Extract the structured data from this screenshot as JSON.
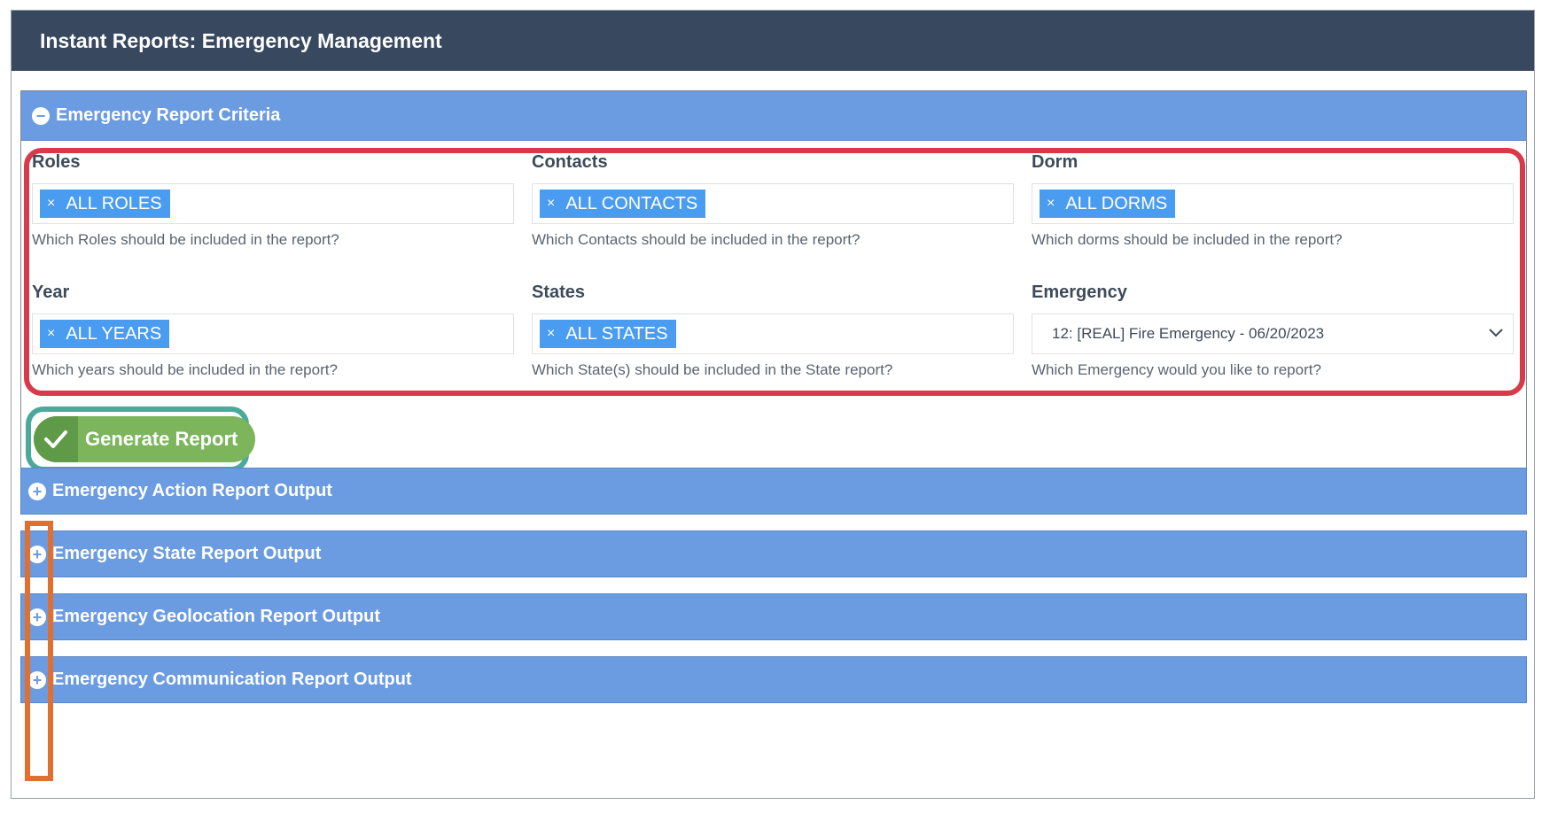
{
  "header": {
    "title": "Instant Reports: Emergency Management"
  },
  "criteria": {
    "title": "Emergency Report Criteria",
    "fields": {
      "roles": {
        "label": "Roles",
        "tag": "ALL ROLES",
        "help": "Which Roles should be included in the report?"
      },
      "contacts": {
        "label": "Contacts",
        "tag": "ALL CONTACTS",
        "help": "Which Contacts should be included in the report?"
      },
      "dorm": {
        "label": "Dorm",
        "tag": "ALL DORMS",
        "help": "Which dorms should be included in the report?"
      },
      "year": {
        "label": "Year",
        "tag": "ALL YEARS",
        "help": "Which years should be included in the report?"
      },
      "states": {
        "label": "States",
        "tag": "ALL STATES",
        "help": "Which State(s) should be included in the State report?"
      },
      "emergency": {
        "label": "Emergency",
        "value": "12: [REAL] Fire Emergency - 06/20/2023",
        "help": "Which Emergency would you like to report?"
      }
    },
    "tag_remove": "×",
    "generate_label": "Generate Report"
  },
  "outputs": [
    {
      "title": "Emergency Action Report Output"
    },
    {
      "title": "Emergency State Report Output"
    },
    {
      "title": "Emergency Geolocation Report Output"
    },
    {
      "title": "Emergency Communication Report Output"
    }
  ],
  "colors": {
    "header_bg": "#37485f",
    "panel_bg": "#6b9be0",
    "tag_bg": "#4a9cf0",
    "button_green": "#7cb55c",
    "highlight_red": "#d93a4a",
    "highlight_teal": "#4aa99a",
    "highlight_orange": "#e0702f"
  },
  "icons": {
    "collapse": "minus-circle-icon",
    "expand": "plus-circle-icon",
    "check": "check-icon",
    "dropdown": "chevron-down-icon"
  }
}
